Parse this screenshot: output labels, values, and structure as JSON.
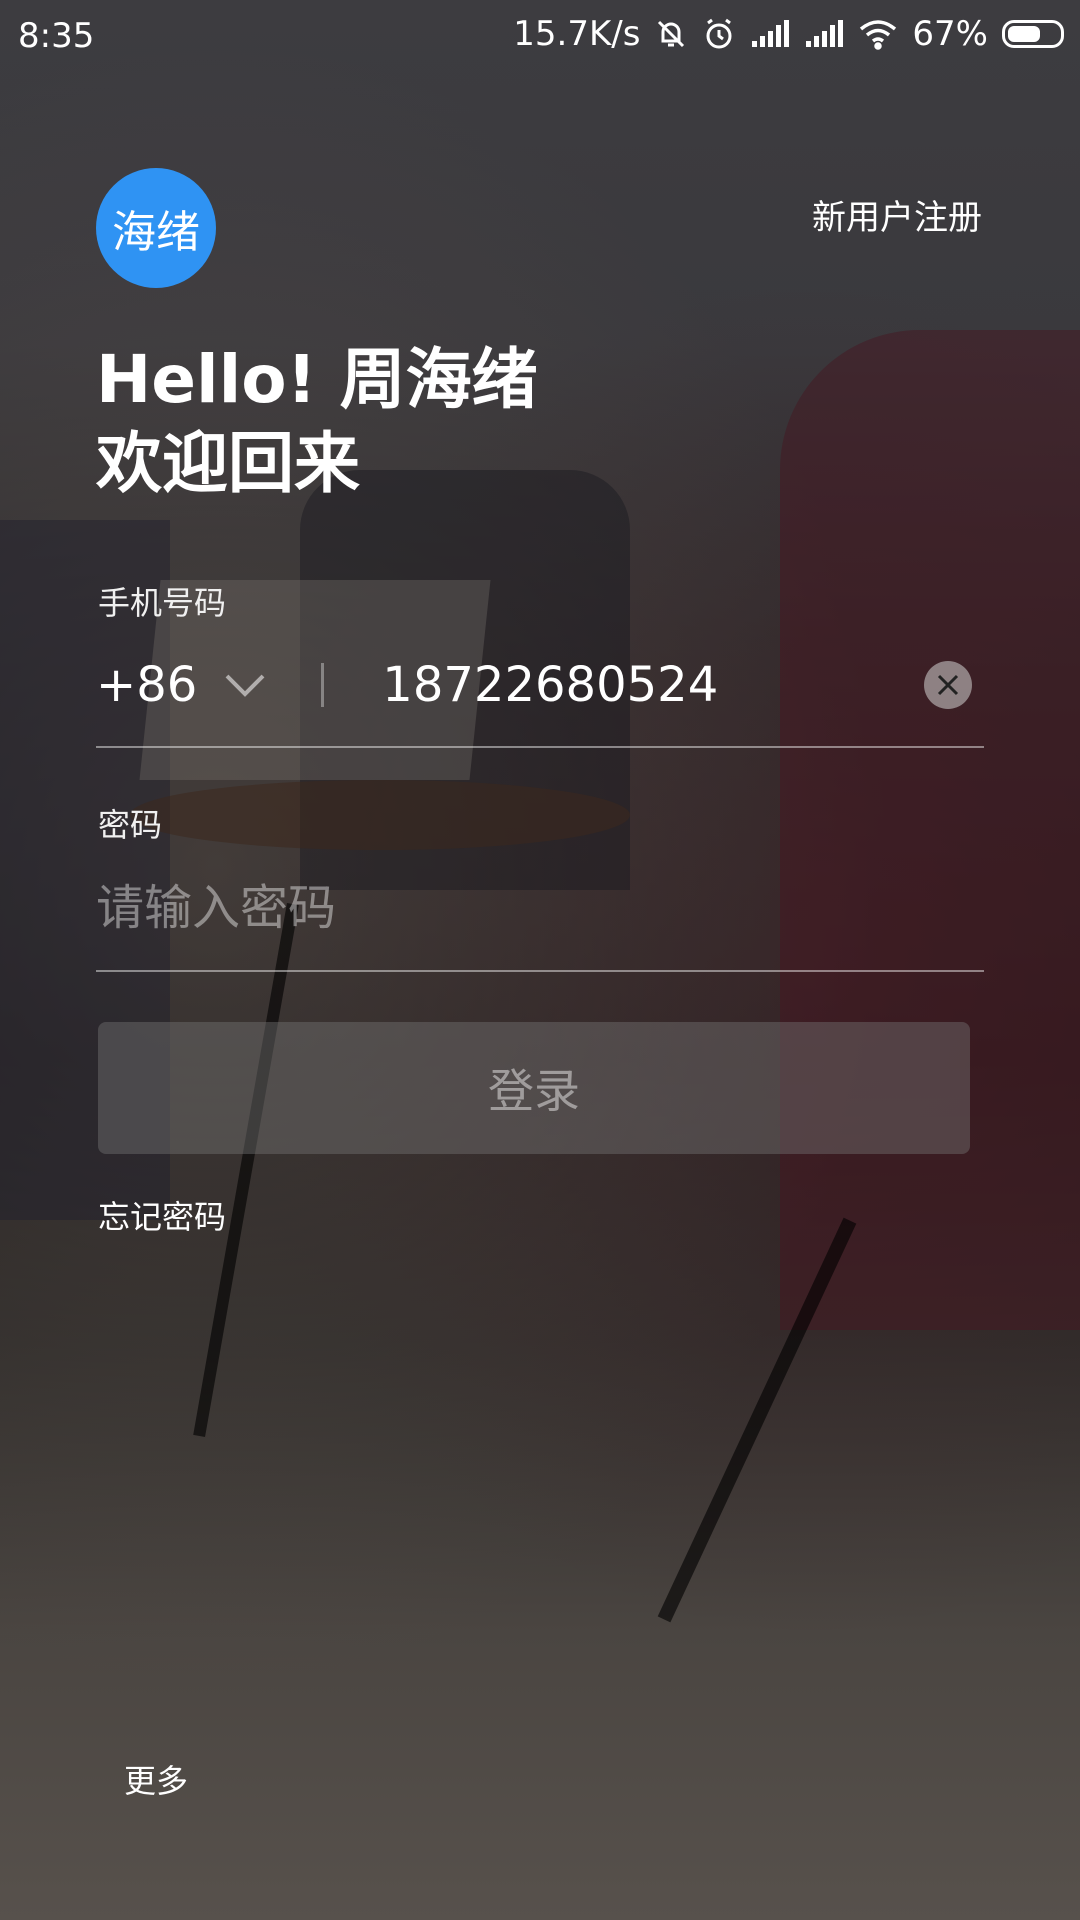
{
  "status_bar": {
    "time": "8:35",
    "network_speed": "15.7K/s",
    "battery_percent": "67%",
    "battery_level": 0.67,
    "icons": [
      "bell-muted-icon",
      "alarm-icon",
      "signal-icon",
      "signal-icon",
      "wifi-icon",
      "battery-icon"
    ]
  },
  "header": {
    "logo_text": "海绪",
    "logo_color": "#2f93f3",
    "register_label": "新用户注册"
  },
  "greeting": {
    "line1": "Hello! 周海绪",
    "line2": "欢迎回来"
  },
  "phone": {
    "label": "手机号码",
    "country_code": "+86",
    "value": "18722680524"
  },
  "password": {
    "label": "密码",
    "placeholder": "请输入密码",
    "value": ""
  },
  "actions": {
    "login_label": "登录",
    "forgot_label": "忘记密码",
    "more_label": "更多"
  }
}
